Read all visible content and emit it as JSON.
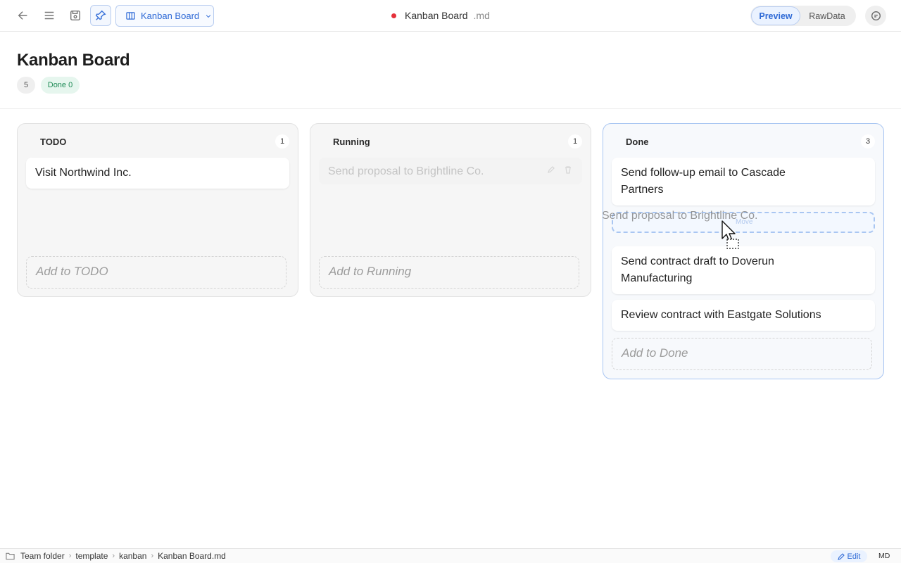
{
  "topbar": {
    "view_label": "Kanban Board",
    "doc_name": "Kanban Board",
    "doc_ext": ".md",
    "preview_label": "Preview",
    "rawdata_label": "RawData"
  },
  "header": {
    "title": "Kanban Board",
    "count": "5",
    "done_badge": "Done 0"
  },
  "columns": [
    {
      "name": "TODO",
      "count": "1",
      "cards": [
        "Visit Northwind Inc."
      ],
      "add_placeholder": "Add to TODO"
    },
    {
      "name": "Running",
      "count": "1",
      "ghost_card": "Send proposal to Brightline Co.",
      "add_placeholder": "Add to Running"
    },
    {
      "name": "Done",
      "count": "3",
      "cards": [
        "Send follow-up email to Cascade Partners",
        "Send contract draft to Doverun Manufacturing",
        "Review contract with Eastgate Solutions"
      ],
      "add_placeholder": "Add to Done"
    }
  ],
  "drag": {
    "card_text": "Send proposal to Brightline Co.",
    "move_label": "Move"
  },
  "statusbar": {
    "crumbs": [
      "Team folder",
      "template",
      "kanban",
      "Kanban Board.md"
    ],
    "edit_label": "Edit",
    "format": "MD"
  },
  "colors": {
    "accent": "#2f6ad6",
    "done_green": "#1e8a55",
    "unsaved_dot": "#e5303a"
  }
}
